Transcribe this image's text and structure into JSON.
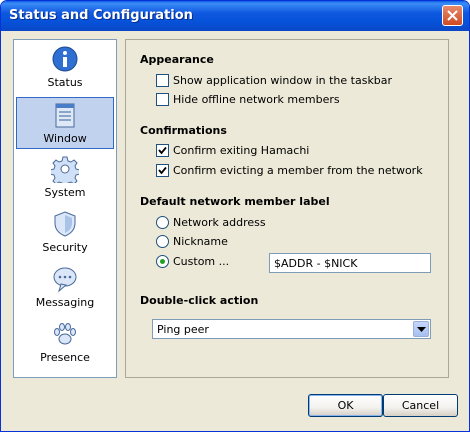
{
  "window": {
    "title": "Status and Configuration"
  },
  "sidebar": {
    "items": [
      {
        "label": "Status",
        "icon": "info-icon",
        "selected": false
      },
      {
        "label": "Window",
        "icon": "window-icon",
        "selected": true
      },
      {
        "label": "System",
        "icon": "gear-icon",
        "selected": false
      },
      {
        "label": "Security",
        "icon": "shield-icon",
        "selected": false
      },
      {
        "label": "Messaging",
        "icon": "chat-bubble-icon",
        "selected": false
      },
      {
        "label": "Presence",
        "icon": "paw-icon",
        "selected": false
      }
    ]
  },
  "appearance": {
    "title": "Appearance",
    "show_taskbar": {
      "label": "Show application window in the taskbar",
      "checked": false
    },
    "hide_offline": {
      "label": "Hide offline network members",
      "checked": false
    }
  },
  "confirmations": {
    "title": "Confirmations",
    "confirm_exit": {
      "label": "Confirm exiting Hamachi",
      "checked": true
    },
    "confirm_evict": {
      "label": "Confirm evicting a member from the network",
      "checked": true
    }
  },
  "member_label": {
    "title": "Default network member label",
    "options": [
      {
        "label": "Network address",
        "selected": false
      },
      {
        "label": "Nickname",
        "selected": false
      },
      {
        "label": "Custom ...",
        "selected": true
      }
    ],
    "custom_value": "$ADDR - $NICK"
  },
  "double_click": {
    "title": "Double-click action",
    "selected": "Ping peer"
  },
  "buttons": {
    "ok": "OK",
    "cancel": "Cancel"
  },
  "colors": {
    "titlebar": "#0a5ee6",
    "selection": "#c1d2ee",
    "radio_dot": "#21a121"
  }
}
